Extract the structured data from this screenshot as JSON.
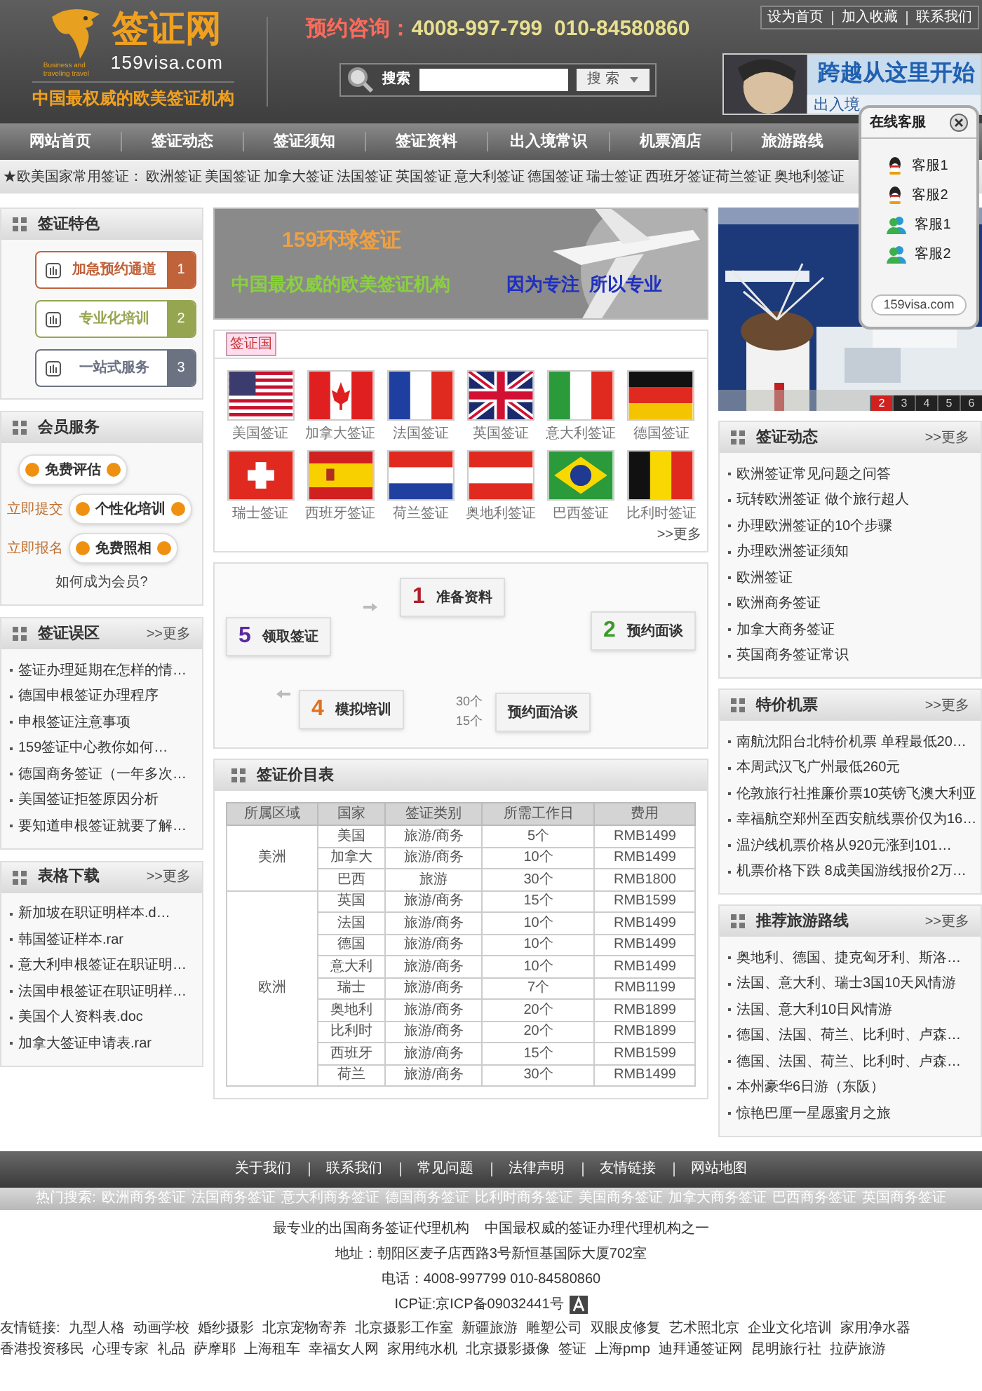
{
  "header": {
    "logo_title": "签证网",
    "logo_domain": "159visa.com",
    "logo_small_text": "Business and traveling travel",
    "logo_tagline": "中国最权威的欧美签证机构",
    "hotline_label": "预约咨询：",
    "hotline_numbers": "4008-997-799  010-84580860",
    "search_label": "搜索",
    "search_button": "搜 索",
    "top_links": [
      "设为首页",
      "加入收藏",
      "联系我们"
    ],
    "banner_title": "跨越从这里开始",
    "banner_subtitle": "出入境"
  },
  "nav": [
    "网站首页",
    "签证动态",
    "签证须知",
    "签证资料",
    "出入境常识",
    "机票酒店",
    "旅游路线"
  ],
  "subnav": {
    "label": "★欧美国家常用签证：",
    "links": [
      "欧洲签证",
      "美国签证",
      "加拿大签证",
      "法国签证",
      "英国签证",
      "意大利签证",
      "德国签证",
      "瑞士签证",
      "西班牙签证荷兰签证",
      "奥地利签证"
    ]
  },
  "online_service": {
    "title": "在线客服",
    "agents": [
      {
        "kind": "qq",
        "label": "客服1"
      },
      {
        "kind": "qq",
        "label": "客服2"
      },
      {
        "kind": "msn",
        "label": "客服1"
      },
      {
        "kind": "msn",
        "label": "客服2"
      }
    ],
    "footer": "159visa.com"
  },
  "features": {
    "title": "签证特色",
    "items": [
      {
        "label": "加急预约通道",
        "number": "1",
        "color": "#c0623a"
      },
      {
        "label": "专业化培训",
        "number": "2",
        "color": "#96a550"
      },
      {
        "label": "一站式服务",
        "number": "3",
        "color": "#6b7282"
      }
    ]
  },
  "member": {
    "title": "会员服务",
    "rows": [
      {
        "prefix": "",
        "label": "免费评估"
      },
      {
        "prefix": "立即提交",
        "label": "个性化培训"
      },
      {
        "prefix": "立即报名",
        "label": "免费照相"
      }
    ],
    "link": "如何成为会员?"
  },
  "mistakes": {
    "title": "签证误区",
    "more": ">>更多",
    "items": [
      "签证办理延期在怎样的情…",
      "德国申根签证办理程序",
      "申根签证注意事项",
      "159签证中心教你如何…",
      "德国商务签证（一年多次…",
      "美国签证拒签原因分析",
      "要知道申根签证就要了解…"
    ]
  },
  "downloads": {
    "title": "表格下载",
    "more": ">>更多",
    "items": [
      "新加坡在职证明样本.d…",
      "韩国签证样本.rar",
      "意大利申根签证在职证明…",
      "法国申根签证在职证明样…",
      "美国个人资料表.doc",
      "加拿大签证申请表.rar"
    ]
  },
  "center_banner": {
    "title": "159环球签证",
    "slogan": "中国最权威的欧美签证机构",
    "motto": "因为专注  所以专业"
  },
  "countries": {
    "tag": "签证国",
    "more": ">>更多",
    "items": [
      {
        "kind": "us",
        "label": "美国签证"
      },
      {
        "kind": "ca",
        "label": "加拿大签证"
      },
      {
        "kind": "fr",
        "label": "法国签证"
      },
      {
        "kind": "gb",
        "label": "英国签证"
      },
      {
        "kind": "it",
        "label": "意大利签证"
      },
      {
        "kind": "de",
        "label": "德国签证"
      },
      {
        "kind": "ch",
        "label": "瑞士签证"
      },
      {
        "kind": "es",
        "label": "西班牙签证"
      },
      {
        "kind": "nl",
        "label": "荷兰签证"
      },
      {
        "kind": "at",
        "label": "奥地利签证"
      },
      {
        "kind": "br",
        "label": "巴西签证"
      },
      {
        "kind": "be",
        "label": "比利时签证"
      }
    ]
  },
  "process": {
    "steps": [
      {
        "number": "1",
        "label": "准备资料",
        "color": "#b0202a"
      },
      {
        "number": "2",
        "label": "预约面谈",
        "color": "#3a9a2a"
      },
      {
        "label": "预约面洽谈"
      },
      {
        "number": "4",
        "label": "模拟培训",
        "color": "#e07020"
      },
      {
        "number": "5",
        "label": "领取签证",
        "color": "#5a2aa0"
      }
    ],
    "fragments": [
      "30个",
      "15个"
    ]
  },
  "prices": {
    "title": "签证价目表",
    "columns": [
      "所属区域",
      "国家",
      "签证类别",
      "所需工作日",
      "费用"
    ],
    "groups": [
      {
        "region": "美洲",
        "rows": [
          [
            "美国",
            "旅游/商务",
            "5个",
            "RMB1499"
          ],
          [
            "加拿大",
            "旅游/商务",
            "10个",
            "RMB1499"
          ],
          [
            "巴西",
            "旅游",
            "30个",
            "RMB1800"
          ]
        ]
      },
      {
        "region": "欧洲",
        "rows": [
          [
            "英国",
            "旅游/商务",
            "15个",
            "RMB1599"
          ],
          [
            "法国",
            "旅游/商务",
            "10个",
            "RMB1499"
          ],
          [
            "德国",
            "旅游/商务",
            "10个",
            "RMB1499"
          ],
          [
            "意大利",
            "旅游/商务",
            "10个",
            "RMB1499"
          ],
          [
            "瑞士",
            "旅游/商务",
            "7个",
            "RMB1199"
          ],
          [
            "奥地利",
            "旅游/商务",
            "20个",
            "RMB1899"
          ],
          [
            "比利时",
            "旅游/商务",
            "20个",
            "RMB1899"
          ],
          [
            "西班牙",
            "旅游/商务",
            "15个",
            "RMB1599"
          ],
          [
            "荷兰",
            "旅游/商务",
            "30个",
            "RMB1499"
          ]
        ]
      }
    ]
  },
  "slides": [
    {
      "label": "2",
      "selected": true
    },
    {
      "label": "3",
      "selected": false
    },
    {
      "label": "4",
      "selected": false
    },
    {
      "label": "5",
      "selected": false
    },
    {
      "label": "6",
      "selected": false
    }
  ],
  "news": {
    "title": "签证动态",
    "more": ">>更多",
    "items": [
      "欧洲签证常见问题之问答",
      "玩转欧洲签证 做个旅行超人",
      "办理欧洲签证的10个步骤",
      "办理欧洲签证须知",
      "欧洲签证",
      "欧洲商务签证",
      "加拿大商务签证",
      "英国商务签证常识"
    ]
  },
  "tickets": {
    "title": "特价机票",
    "more": ">>更多",
    "items": [
      "南航沈阳台北特价机票 单程最低20…",
      "本周武汉飞广州最低260元",
      "伦敦旅行社推廉价票10英镑飞澳大利亚",
      "幸福航空郑州至西安航线票价仅为16…",
      "温沪线机票价格从920元涨到101…",
      "机票价格下跌 8成美国游线报价2万…"
    ]
  },
  "routes": {
    "title": "推荐旅游路线",
    "more": ">>更多",
    "items": [
      "奥地利、德国、捷克匈牙利、斯洛…",
      "法国、意大利、瑞士3国10天风情游",
      "法国、意大利10日风情游",
      "德国、法国、荷兰、比利时、卢森…",
      "德国、法国、荷兰、比利时、卢森…",
      "本州豪华6日游（东阪）",
      "惊艳巴厘一星愿蜜月之旅"
    ]
  },
  "footer": {
    "nav": [
      "关于我们",
      "联系我们",
      "常见问题",
      "法律声明",
      "友情链接",
      "网站地图"
    ],
    "hot_label": "热门搜索:",
    "hot_links": [
      "欧洲商务签证",
      "法国商务签证",
      "意大利商务签证",
      "德国商务签证",
      "比利时商务签证",
      "美国商务签证",
      "加拿大商务签证",
      "巴西商务签证",
      "英国商务签证"
    ],
    "lines": [
      "最专业的出国商务签证代理机构    中国最权威的签证办理代理机构之一",
      "地址：朝阳区麦子店西路3号新恒基国际大厦702室",
      "电话：4008-997799 010-84580860"
    ],
    "icp": "ICP证:京ICP备09032441号",
    "friends_label": "友情链接:",
    "friends": [
      "九型人格",
      "动画学校",
      "婚纱摄影",
      "北京宠物寄养",
      "北京摄影工作室",
      "新疆旅游",
      "雕塑公司",
      "双眼皮修复",
      "艺术照北京",
      "企业文化培训",
      "家用净水器",
      "香港投资移民",
      "心理专家",
      "礼品",
      "萨摩耶",
      "上海租车",
      "幸福女人网",
      "家用纯水机",
      "北京摄影摄像",
      "签证",
      "上海pmp",
      "迪拜通签证网",
      "昆明旅行社",
      "拉萨旅游"
    ]
  }
}
